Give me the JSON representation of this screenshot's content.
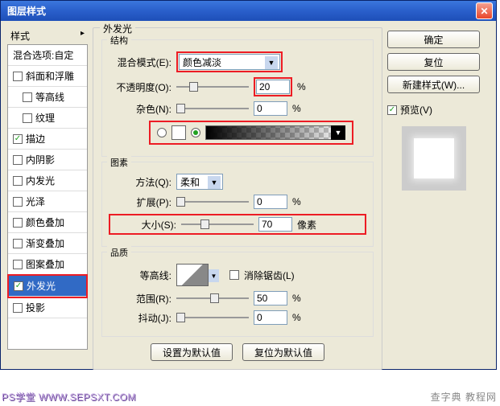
{
  "titlebar": {
    "text": "图层样式"
  },
  "left": {
    "title": "样式",
    "blend_default": "混合选项:自定",
    "items": [
      {
        "label": "斜面和浮雕",
        "checked": false
      },
      {
        "label": "等高线",
        "checked": false,
        "sub": true
      },
      {
        "label": "纹理",
        "checked": false,
        "sub": true
      },
      {
        "label": "描边",
        "checked": true
      },
      {
        "label": "内阴影",
        "checked": false
      },
      {
        "label": "内发光",
        "checked": false
      },
      {
        "label": "光泽",
        "checked": false
      },
      {
        "label": "颜色叠加",
        "checked": false
      },
      {
        "label": "渐变叠加",
        "checked": false
      },
      {
        "label": "图案叠加",
        "checked": false
      },
      {
        "label": "外发光",
        "checked": true,
        "selected": true
      },
      {
        "label": "投影",
        "checked": false
      }
    ]
  },
  "mid": {
    "title": "外发光",
    "struct_title": "结构",
    "blend_mode_label": "混合模式(E):",
    "blend_mode_value": "颜色减淡",
    "opacity_label": "不透明度(O):",
    "opacity_value": "20",
    "percent": "%",
    "noise_label": "杂色(N):",
    "noise_value": "0",
    "elements_title": "图素",
    "method_label": "方法(Q):",
    "method_value": "柔和",
    "spread_label": "扩展(P):",
    "spread_value": "0",
    "size_label": "大小(S):",
    "size_value": "70",
    "px": "像素",
    "quality_title": "品质",
    "contour_label": "等高线:",
    "antialias_label": "消除锯齿(L)",
    "range_label": "范围(R):",
    "range_value": "50",
    "jitter_label": "抖动(J):",
    "jitter_value": "0",
    "btn_default": "设置为默认值",
    "btn_reset": "复位为默认值"
  },
  "right": {
    "ok": "确定",
    "cancel": "复位",
    "newstyle": "新建样式(W)...",
    "preview_label": "预览(V)"
  },
  "watermark": {
    "left": "PS学堂  WWW.SEPSXT.COM",
    "right": "查字典 教程网"
  }
}
